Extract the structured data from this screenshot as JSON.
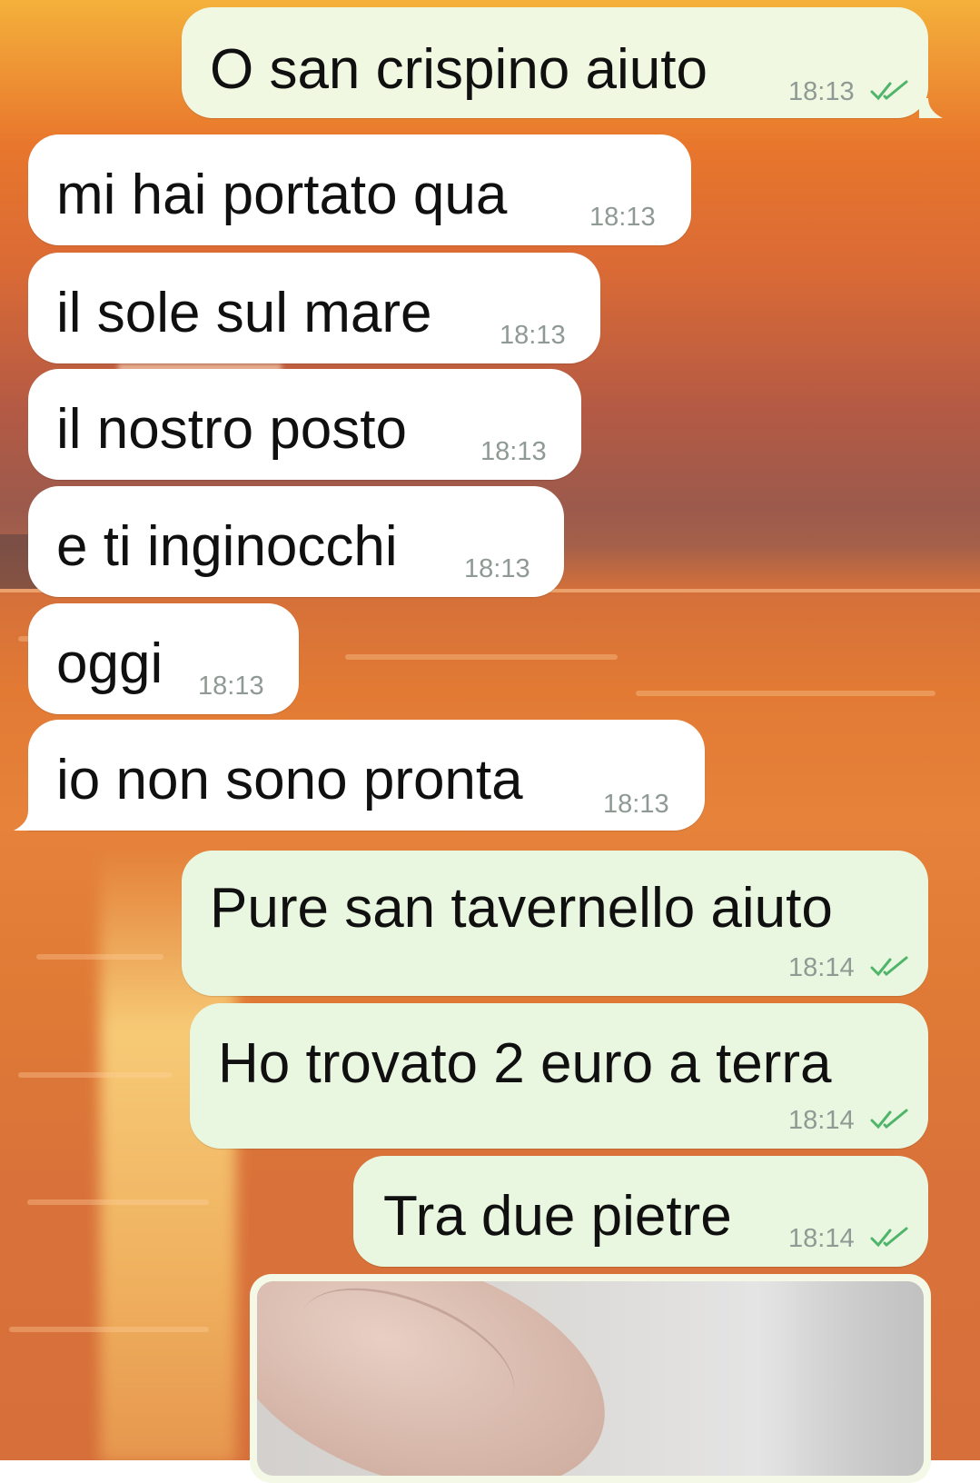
{
  "messages": [
    {
      "direction": "outgoing",
      "text": "O san crispino aiuto",
      "time": "18:13",
      "status": "read"
    },
    {
      "direction": "incoming",
      "text": "mi hai portato qua",
      "time": "18:13"
    },
    {
      "direction": "incoming",
      "text": "il sole sul mare",
      "time": "18:13"
    },
    {
      "direction": "incoming",
      "text": "il nostro posto",
      "time": "18:13"
    },
    {
      "direction": "incoming",
      "text": "e ti inginocchi",
      "time": "18:13"
    },
    {
      "direction": "incoming",
      "text": "oggi",
      "time": "18:13"
    },
    {
      "direction": "incoming",
      "text": "io non sono pronta",
      "time": "18:13"
    },
    {
      "direction": "outgoing",
      "text": "Pure san tavernello aiuto",
      "time": "18:14",
      "status": "read"
    },
    {
      "direction": "outgoing",
      "text": "Ho trovato 2 euro a terra",
      "time": "18:14",
      "status": "read"
    },
    {
      "direction": "outgoing",
      "text": "Tra due pietre",
      "time": "18:14",
      "status": "read"
    },
    {
      "direction": "outgoing",
      "type": "image",
      "status": "partially-visible"
    }
  ],
  "colors": {
    "incoming_bubble": "#ffffff",
    "outgoing_bubble": "#eaf7e0",
    "timestamp": "#8f9a94",
    "read_ticks": "#4fb56a",
    "text": "#101010"
  },
  "icons": {
    "read_receipt": "double-check-icon"
  }
}
